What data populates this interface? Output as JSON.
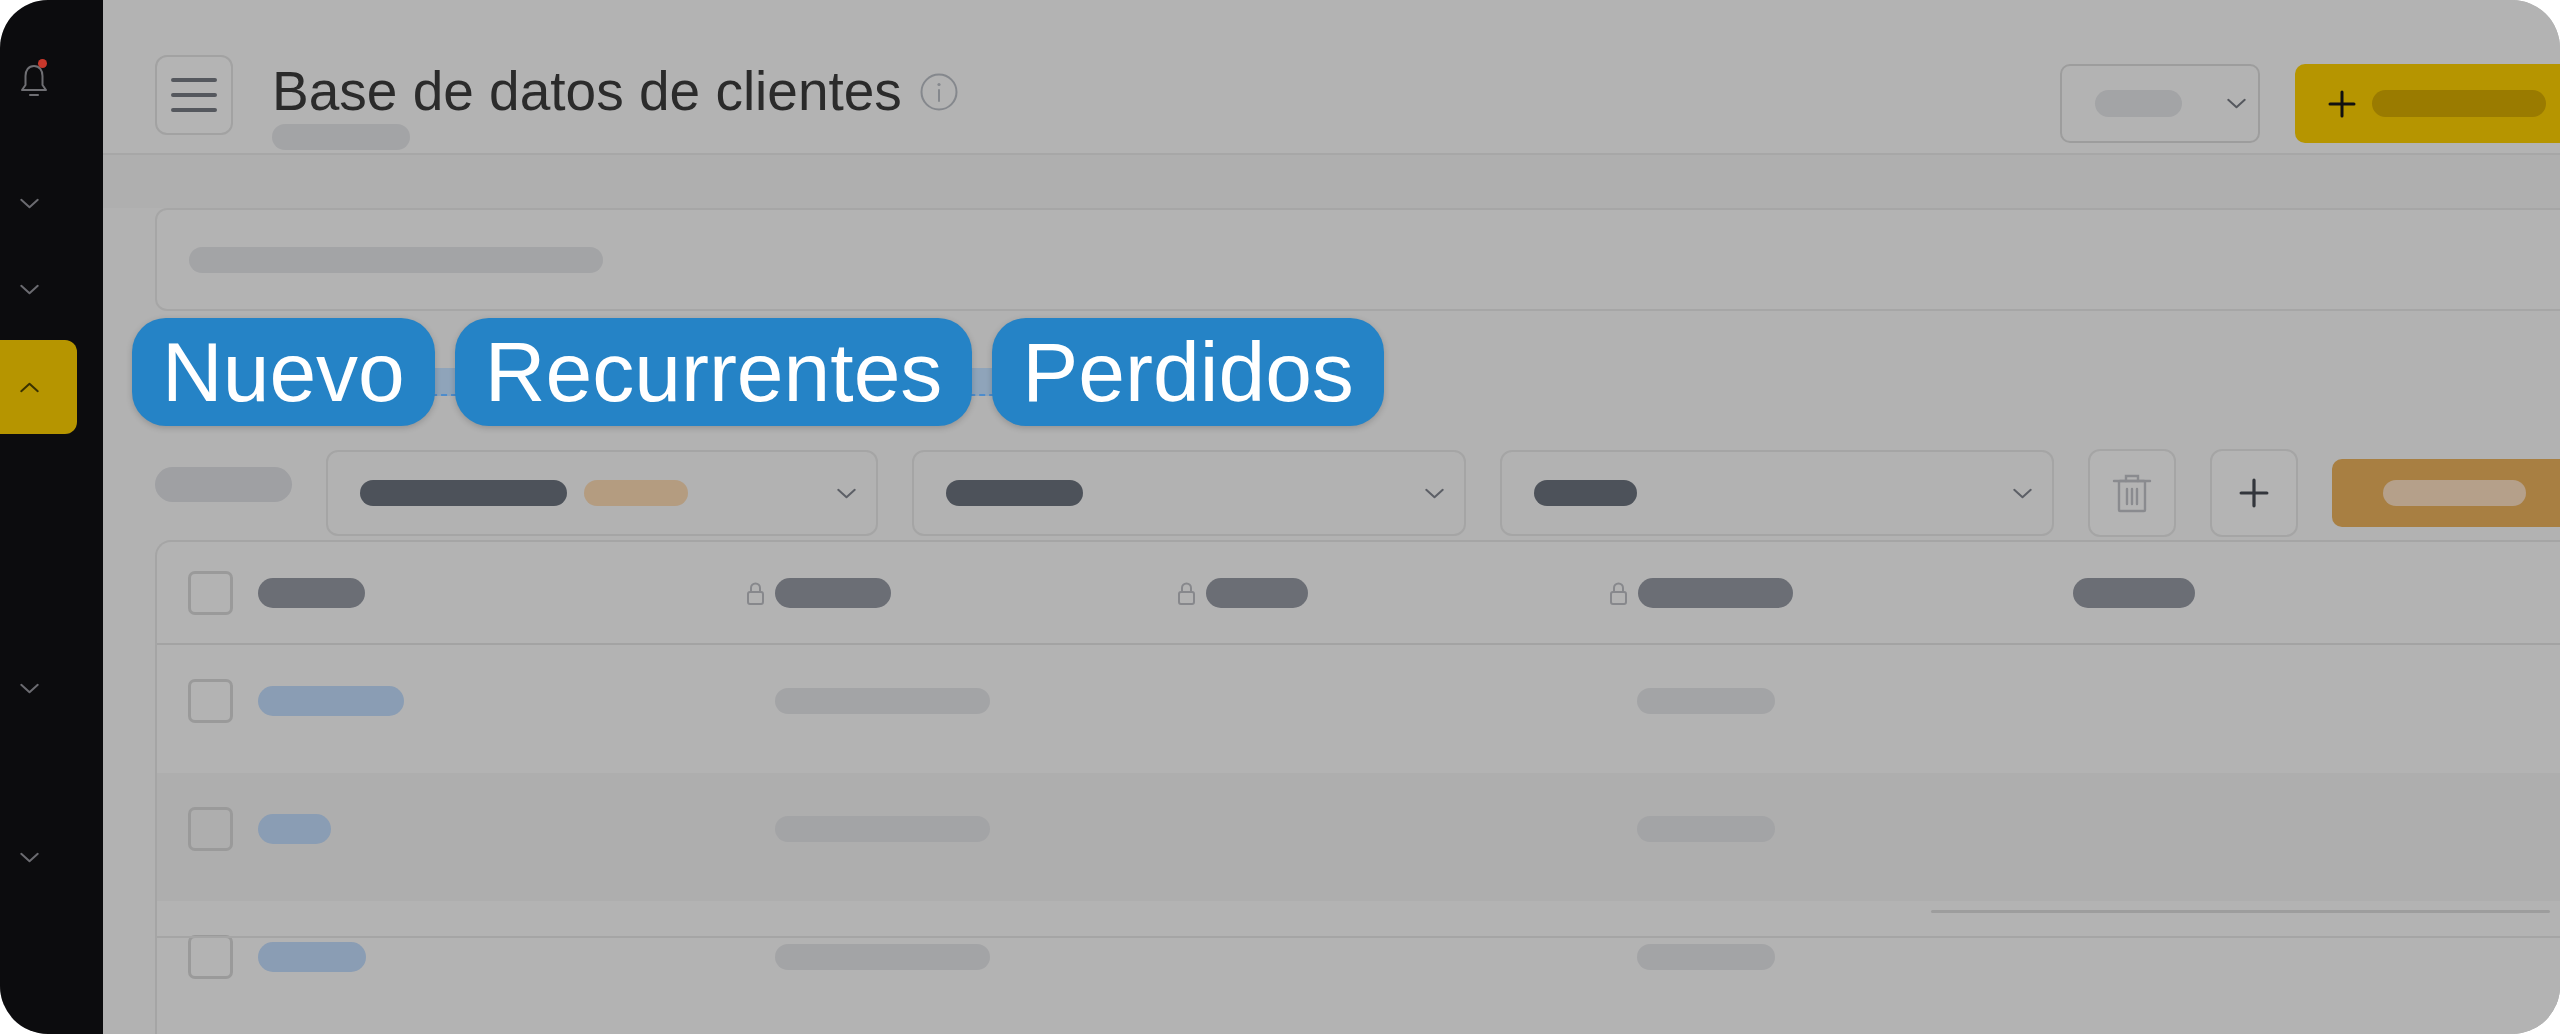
{
  "sidebar": {
    "bell": {
      "unread": true
    },
    "items": [
      {
        "selected": false,
        "expanded": false
      },
      {
        "selected": false,
        "expanded": false
      },
      {
        "selected": true,
        "expanded": true
      },
      {
        "selected": false,
        "expanded": false
      },
      {
        "selected": false,
        "expanded": false
      }
    ]
  },
  "header": {
    "title": "Base de datos de clientes"
  },
  "tabs": [
    {
      "label": "Nuevo"
    },
    {
      "label": "Recurrentes"
    },
    {
      "label": "Perdidos"
    }
  ],
  "table": {
    "header_checkbox": {
      "checked": false
    },
    "rows": [
      {
        "checked": false
      },
      {
        "checked": false
      },
      {
        "checked": false
      }
    ]
  }
}
